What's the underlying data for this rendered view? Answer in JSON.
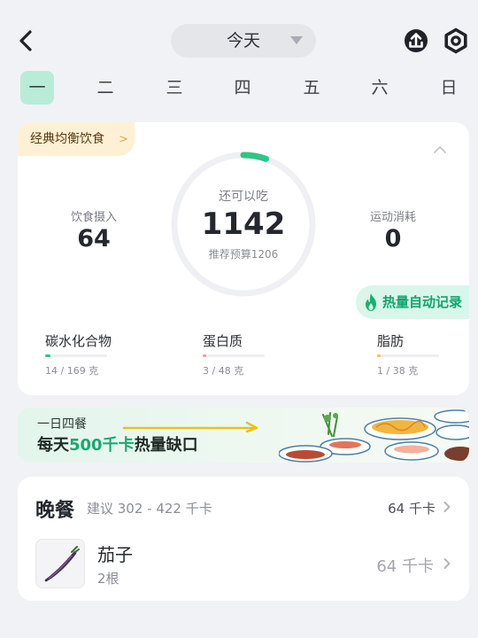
{
  "header": {
    "date_label": "今天",
    "back_icon": "chevron-left-icon",
    "share_icon": "share-icon",
    "settings_icon": "gear-icon"
  },
  "weekdays": [
    "一",
    "二",
    "三",
    "四",
    "五",
    "六",
    "日"
  ],
  "selected_weekday_index": 0,
  "summary": {
    "diet_plan_label": "经典均衡饮食",
    "intake_label": "饮食摄入",
    "intake_value": "64",
    "remaining_label": "还可以吃",
    "remaining_value": "1142",
    "budget_text": "推荐预算1206",
    "budget_progress_fraction": 0.053,
    "exercise_label": "运动消耗",
    "exercise_value": "0",
    "auto_log_label": "热量自动记录",
    "macros": [
      {
        "name": "碳水化合物",
        "amount": "14 / 169 克",
        "fraction": 0.083,
        "color": "#2cc685"
      },
      {
        "name": "蛋白质",
        "amount": "3 / 48 克",
        "fraction": 0.0625,
        "color": "#f29a9a"
      },
      {
        "name": "脂肪",
        "amount": "1 / 38 克",
        "fraction": 0.026,
        "color": "#f2c14e"
      }
    ]
  },
  "banner": {
    "line1": "一日四餐",
    "line2_prefix": "每天",
    "line2_highlight": "500千卡",
    "line2_suffix": "热量缺口"
  },
  "meal": {
    "title": "晚餐",
    "suggestion": "建议 302 - 422 千卡",
    "total": "64 千卡",
    "items": [
      {
        "name": "茄子",
        "quantity": "2根",
        "kcal": "64 千卡"
      }
    ]
  },
  "colors": {
    "accent": "#2cc685",
    "accent_text": "#11a46c",
    "background": "#f1f2f5"
  }
}
